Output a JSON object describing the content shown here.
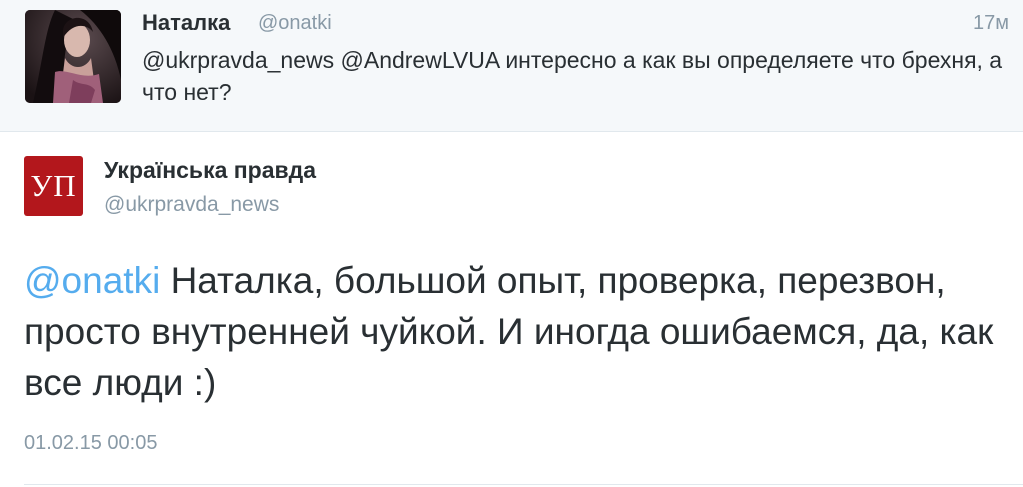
{
  "reply_tweet": {
    "author_name": "Наталка",
    "author_handle": "@onatki",
    "time": "17м",
    "text": "@ukrpravda_news @AndrewLVUA интересно а как вы определяете что брехня, а что нет?"
  },
  "main_tweet": {
    "logo_text": "УП",
    "logo_color": "#b3171c",
    "author_name": "Українська правда",
    "author_handle": "@ukrpravda_news",
    "mention": "@onatki",
    "text": " Наталка, большой опыт, проверка, перезвон, просто внутренней чуйкой. И иногда ошибаемся, да, как все люди :)",
    "date": "01.02.15 00:05"
  },
  "colors": {
    "link": "#55acee",
    "secondary_text": "#8899a6",
    "primary_text": "#292f33",
    "reply_background": "#f5f8fa"
  }
}
